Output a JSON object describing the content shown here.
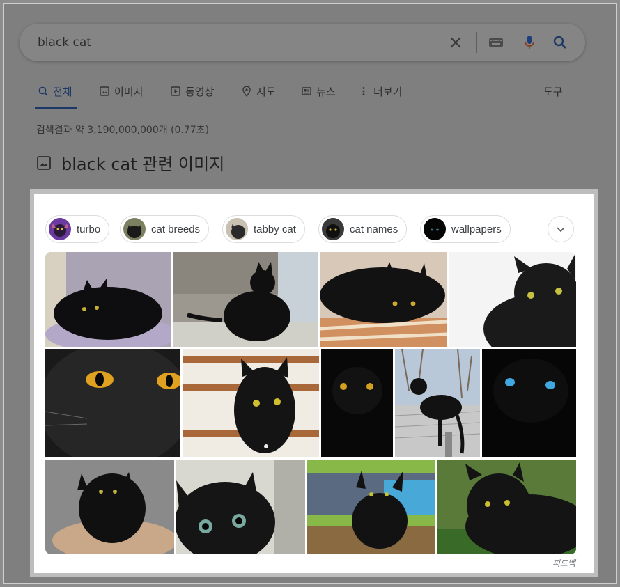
{
  "search": {
    "query": "black cat"
  },
  "tabs": [
    {
      "label": "전체",
      "icon": "search-icon",
      "active": true
    },
    {
      "label": "이미지",
      "icon": "image-icon"
    },
    {
      "label": "동영상",
      "icon": "video-icon"
    },
    {
      "label": "지도",
      "icon": "map-pin-icon"
    },
    {
      "label": "뉴스",
      "icon": "news-icon"
    },
    {
      "label": "더보기",
      "icon": "more-icon"
    }
  ],
  "tools_label": "도구",
  "result_stats": "검색결과 약 3,190,000,000개 (0.77초)",
  "images_section": {
    "title": "black cat 관련 이미지",
    "chips": [
      {
        "label": "turbo"
      },
      {
        "label": "cat breeds"
      },
      {
        "label": "tabby cat"
      },
      {
        "label": "cat names"
      },
      {
        "label": "wallpapers"
      }
    ],
    "feedback_label": "피드백"
  },
  "colors": {
    "accent": "#1a73e8",
    "dim_overlay": "#7f7f7f",
    "mic_red": "#ea4335"
  }
}
